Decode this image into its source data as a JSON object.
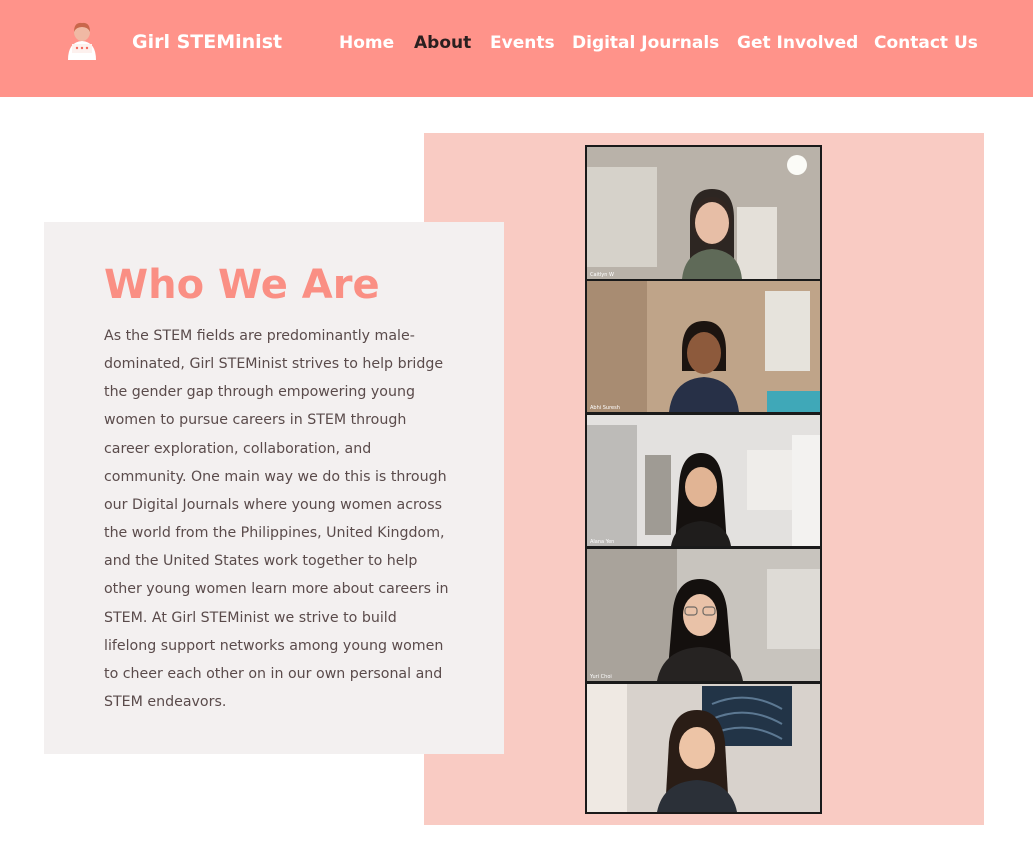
{
  "header": {
    "brand": "Girl STEMinist",
    "nav": [
      {
        "label": "Home",
        "active": false
      },
      {
        "label": "About",
        "active": true
      },
      {
        "label": "Events",
        "active": false
      },
      {
        "label": "Digital Journals",
        "active": false
      },
      {
        "label": "Get Involved",
        "active": false
      },
      {
        "label": "Contact Us",
        "active": false
      }
    ]
  },
  "about": {
    "title": "Who We Are",
    "body": "As the STEM fields are predominantly male-dominated, Girl STEMinist strives to help bridge the gender gap through empowering young women to pursue careers in STEM through career exploration, collaboration, and community. One main way we do this is through our Digital Journals where young women across the world from the Philippines, United Kingdom, and the United States work together to help other young women learn more about careers in STEM. At Girl STEMinist we strive to build lifelong support networks among young women to cheer each other on in our own personal and STEM endeavors."
  },
  "photos": {
    "captions": [
      "Caitlyn W",
      "Abhi Suresh",
      "Alana Yen",
      "Yuri Choi",
      ""
    ]
  },
  "colors": {
    "header_bg": "#ff938a",
    "title": "#fa8f84",
    "panel_bg": "#f9cbc3",
    "card_bg": "#f3f0f0"
  }
}
